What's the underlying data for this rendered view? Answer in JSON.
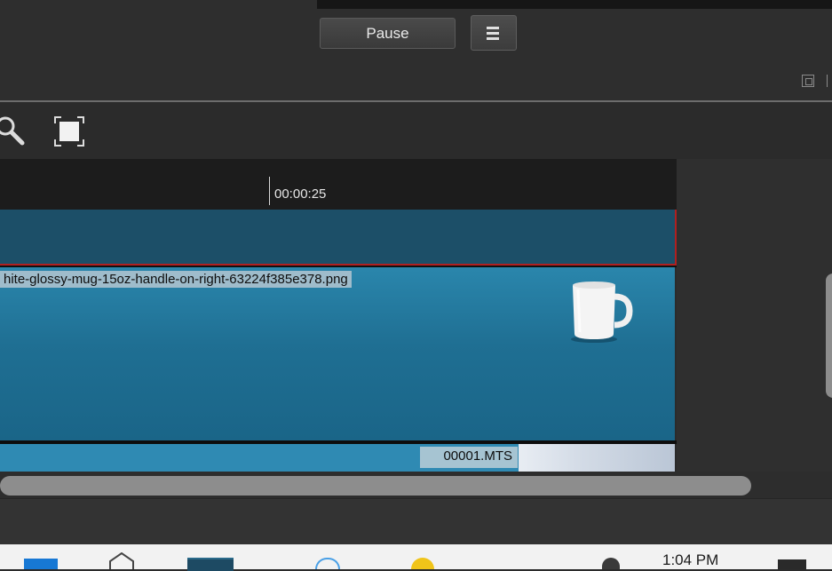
{
  "header": {
    "pause_label": "Pause"
  },
  "icons": {
    "menu": "hamburger-menu-icon",
    "restore": "restore-window-icon",
    "zoom": "zoom-icon",
    "fit": "fit-to-window-icon"
  },
  "timeline": {
    "timecode": "00:00:25",
    "clips": [
      {
        "label": "hite-glossy-mug-15oz-handle-on-right-63224f385e378.png"
      },
      {
        "label": "00001.MTS"
      }
    ]
  },
  "taskbar": {
    "clock": "1:04 PM"
  },
  "colors": {
    "track_top": "#1c4f68",
    "track_image": "#2a86ac",
    "selection_border": "#b02020",
    "ruler_bg": "#1c1c1c"
  }
}
